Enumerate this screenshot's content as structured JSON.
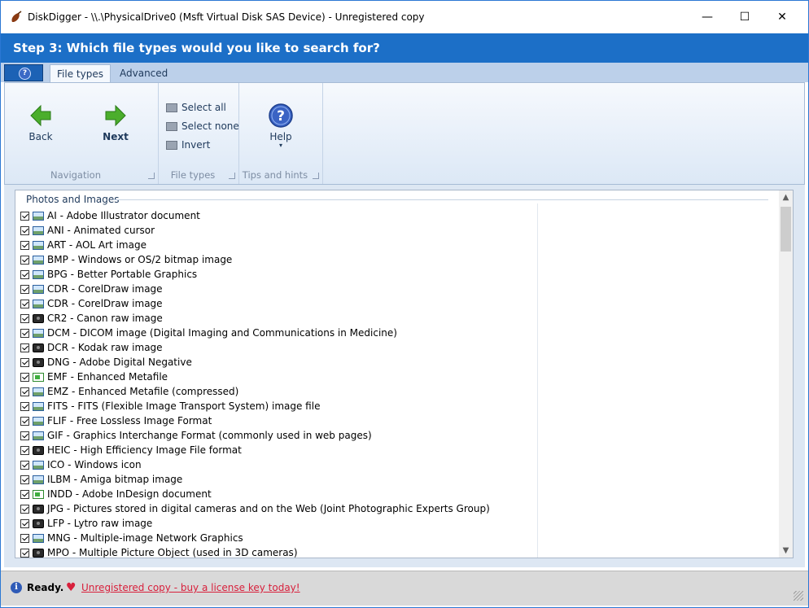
{
  "window": {
    "title": "DiskDigger - \\\\.\\PhysicalDrive0 (Msft Virtual Disk SAS Device) - Unregistered copy",
    "controls": {
      "minimize": "—",
      "maximize": "☐",
      "close": "✕"
    }
  },
  "step": {
    "title": "Step 3: Which file types would you like to search for?"
  },
  "ribbon": {
    "app_tab": {
      "icon": "help-icon",
      "symbol": "?"
    },
    "tabs": [
      {
        "label": "File types",
        "active": true
      },
      {
        "label": "Advanced",
        "active": false
      }
    ],
    "groups": {
      "navigation": {
        "label": "Navigation",
        "back_label": "Back",
        "next_label": "Next"
      },
      "file_types": {
        "label": "File types",
        "select_all": "Select all",
        "select_none": "Select none",
        "invert": "Invert"
      },
      "tips": {
        "label": "Tips and hints",
        "help_label": "Help",
        "help_arrow": "▾"
      }
    }
  },
  "list": {
    "group_header": "Photos and Images",
    "items": [
      {
        "label": "AI - Adobe Illustrator document",
        "checked": true,
        "icon": "image"
      },
      {
        "label": "ANI - Animated cursor",
        "checked": true,
        "icon": "image"
      },
      {
        "label": "ART - AOL Art image",
        "checked": true,
        "icon": "image"
      },
      {
        "label": "BMP - Windows or OS/2 bitmap image",
        "checked": true,
        "icon": "image"
      },
      {
        "label": "BPG - Better Portable Graphics",
        "checked": true,
        "icon": "image"
      },
      {
        "label": "CDR - CorelDraw image",
        "checked": true,
        "icon": "image"
      },
      {
        "label": "CDR - CorelDraw image",
        "checked": true,
        "icon": "image"
      },
      {
        "label": "CR2 - Canon raw image",
        "checked": true,
        "icon": "camera"
      },
      {
        "label": "DCM - DICOM image (Digital Imaging and Communications in Medicine)",
        "checked": true,
        "icon": "image"
      },
      {
        "label": "DCR - Kodak raw image",
        "checked": true,
        "icon": "camera"
      },
      {
        "label": "DNG - Adobe Digital Negative",
        "checked": true,
        "icon": "camera"
      },
      {
        "label": "EMF - Enhanced Metafile",
        "checked": true,
        "icon": "vector"
      },
      {
        "label": "EMZ - Enhanced Metafile (compressed)",
        "checked": true,
        "icon": "image"
      },
      {
        "label": "FITS - FITS (Flexible Image Transport System) image file",
        "checked": true,
        "icon": "image"
      },
      {
        "label": "FLIF - Free Lossless Image Format",
        "checked": true,
        "icon": "image"
      },
      {
        "label": "GIF - Graphics Interchange Format (commonly used in web pages)",
        "checked": true,
        "icon": "image"
      },
      {
        "label": "HEIC - High Efficiency Image File format",
        "checked": true,
        "icon": "camera"
      },
      {
        "label": "ICO - Windows icon",
        "checked": true,
        "icon": "image"
      },
      {
        "label": "ILBM - Amiga bitmap image",
        "checked": true,
        "icon": "image"
      },
      {
        "label": "INDD - Adobe InDesign document",
        "checked": true,
        "icon": "vector"
      },
      {
        "label": "JPG - Pictures stored in digital cameras and on the Web (Joint Photographic Experts Group)",
        "checked": true,
        "icon": "camera"
      },
      {
        "label": "LFP - Lytro raw image",
        "checked": true,
        "icon": "camera"
      },
      {
        "label": "MNG - Multiple-image Network Graphics",
        "checked": true,
        "icon": "image"
      },
      {
        "label": "MPO - Multiple Picture Object (used in 3D cameras)",
        "checked": true,
        "icon": "camera"
      }
    ],
    "scroll_up": "▲",
    "scroll_down": "▼"
  },
  "status": {
    "info_symbol": "i",
    "text": "Ready.",
    "heart_symbol": "♥",
    "link": "Unregistered copy - buy a license key today!"
  },
  "colors": {
    "accent": "#1c6fc7",
    "ribbon_bg": "#dce8f6",
    "link_red": "#d8203c"
  }
}
